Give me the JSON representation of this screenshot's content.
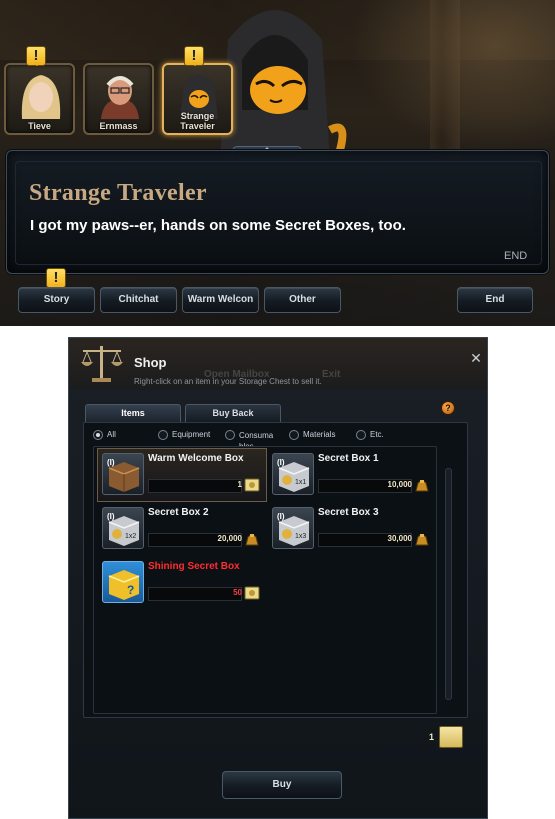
{
  "dialogue": {
    "characters": [
      {
        "name": "Tieve",
        "has_quest": true
      },
      {
        "name": "Ernmass",
        "has_quest": false
      },
      {
        "name": "Strange Traveler",
        "has_quest": true,
        "active": true
      }
    ],
    "speaker": "Strange Traveler",
    "text": "I got my paws--er, hands on some Secret Boxes, too.",
    "end_label": "END",
    "buttons": [
      {
        "label": "Story",
        "has_quest": true
      },
      {
        "label": "Chitchat"
      },
      {
        "label": "Warm Welcon"
      },
      {
        "label": "Other"
      },
      {
        "label": "End"
      }
    ]
  },
  "shop": {
    "title": "Shop",
    "subtitle": "Right-click on an item in your Storage Chest to sell it.",
    "ghost_labels": [
      "Open Mailbox",
      "Exit"
    ],
    "tabs": [
      {
        "label": "Items",
        "active": true
      },
      {
        "label": "Buy Back",
        "active": false
      }
    ],
    "filters": [
      {
        "label": "All",
        "selected": true
      },
      {
        "label": "Equipment",
        "selected": false
      },
      {
        "label": "Consuma\nbles",
        "selected": false
      },
      {
        "label": "Materials",
        "selected": false
      },
      {
        "label": "Etc.",
        "selected": false
      }
    ],
    "items": [
      {
        "name": "Warm Welcome Box",
        "price": "1",
        "currency": "welcome-coupon",
        "selected": true,
        "highlight": false
      },
      {
        "name": "Secret Box 1",
        "price": "10,000",
        "currency": "gold-pouch",
        "selected": false,
        "highlight": false
      },
      {
        "name": "Secret Box 2",
        "price": "20,000",
        "currency": "gold-pouch",
        "selected": false,
        "highlight": false
      },
      {
        "name": "Secret Box 3",
        "price": "30,000",
        "currency": "gold-pouch",
        "selected": false,
        "highlight": false
      },
      {
        "name": "Shining Secret Box",
        "price": "50",
        "currency": "welcome-coupon",
        "selected": false,
        "highlight": true
      }
    ],
    "wallet": {
      "count": "1",
      "icon": "welcome-coupon"
    },
    "buy_label": "Buy",
    "accent": "#e3b25a"
  }
}
